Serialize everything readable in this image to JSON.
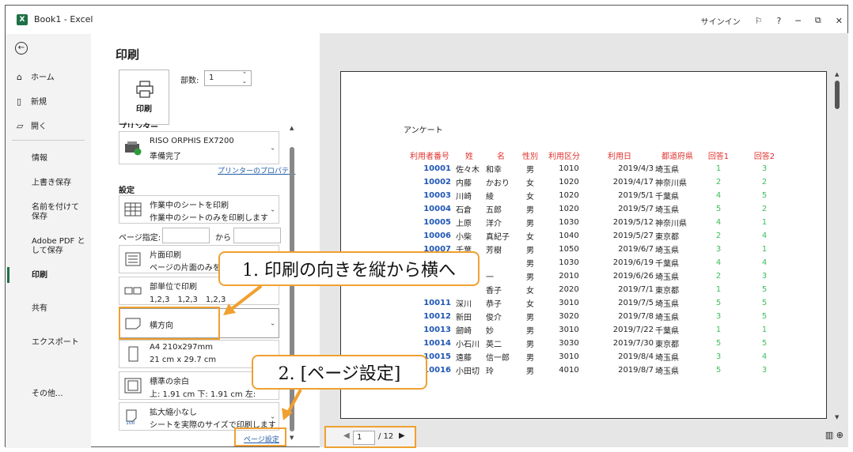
{
  "window": {
    "app_icon": "X",
    "title": "Book1 - Excel",
    "sign_in": "サインイン",
    "help": "?",
    "minimize": "─",
    "restore": "⧉",
    "close": "✕"
  },
  "backstage": {
    "back_icon": "←",
    "items": [
      {
        "icon": "⌂",
        "label": "ホーム"
      },
      {
        "icon": "▯",
        "label": "新規"
      },
      {
        "icon": "▱",
        "label": "開く"
      }
    ],
    "sub_items": [
      "情報",
      "上書き保存",
      "名前を付けて保存",
      "Adobe PDF として保存",
      "印刷",
      "共有",
      "エクスポート",
      "その他..."
    ]
  },
  "print": {
    "heading": "印刷",
    "print_button": "印刷",
    "copies_label": "部数:",
    "copies_value": "1",
    "printer_section": "プリンター",
    "printer_name": "RISO ORPHIS EX7200",
    "printer_status": "準備完了",
    "printer_properties": "プリンターのプロパティ",
    "settings_section": "設定",
    "scope_title": "作業中のシートを印刷",
    "scope_desc": "作業中のシートのみを印刷します",
    "pages_label": "ページ指定:",
    "pages_to": "から",
    "sides_title": "片面印刷",
    "sides_desc": "ページの片面のみを印刷",
    "collate_title": "部単位で印刷",
    "collate_desc": "1,2,3　1,2,3　1,2,3",
    "orientation": "横方向",
    "paper_title": "A4 210x297mm",
    "paper_desc": "21 cm x 29.7 cm",
    "margins_title": "標準の余白",
    "margins_desc": "上: 1.91 cm 下: 1.91 cm 左:",
    "scaling_title": "拡大縮小なし",
    "scaling_desc": "シートを実際のサイズで印刷します",
    "page_setup_link": "ページ設定"
  },
  "preview": {
    "sheet_title": "アンケート",
    "headers": [
      "利用者番号",
      "姓",
      "名",
      "性別",
      "利用区分",
      "利用日",
      "都道府県",
      "回答1",
      "回答2"
    ],
    "rows": [
      [
        "10001",
        "佐々木",
        "和幸",
        "男",
        "1010",
        "2019/4/3",
        "埼玉県",
        "1",
        "3"
      ],
      [
        "10002",
        "内藤",
        "かおり",
        "女",
        "1020",
        "2019/4/17",
        "神奈川県",
        "2",
        "2"
      ],
      [
        "10003",
        "川崎",
        "綾",
        "女",
        "1020",
        "2019/5/1",
        "千葉県",
        "4",
        "5"
      ],
      [
        "10004",
        "石倉",
        "五郎",
        "男",
        "1020",
        "2019/5/7",
        "埼玉県",
        "5",
        "2"
      ],
      [
        "10005",
        "上原",
        "洋介",
        "男",
        "1030",
        "2019/5/12",
        "神奈川県",
        "4",
        "1"
      ],
      [
        "10006",
        "小柴",
        "真紀子",
        "女",
        "1040",
        "2019/5/27",
        "東京都",
        "2",
        "4"
      ],
      [
        "10007",
        "千葉",
        "芳樹",
        "男",
        "1050",
        "2019/6/7",
        "埼玉県",
        "3",
        "1"
      ],
      [
        "",
        "",
        "",
        "男",
        "1030",
        "2019/6/19",
        "千葉県",
        "4",
        "4"
      ],
      [
        "",
        "",
        "一",
        "男",
        "2010",
        "2019/6/26",
        "埼玉県",
        "2",
        "3"
      ],
      [
        "",
        "",
        "香子",
        "女",
        "2020",
        "2019/7/1",
        "東京都",
        "1",
        "5"
      ],
      [
        "10011",
        "深川",
        "恭子",
        "女",
        "3010",
        "2019/7/5",
        "埼玉県",
        "5",
        "5"
      ],
      [
        "10012",
        "新田",
        "俊介",
        "男",
        "3020",
        "2019/7/8",
        "埼玉県",
        "3",
        "5"
      ],
      [
        "10013",
        "劒崎",
        "妙",
        "男",
        "3010",
        "2019/7/22",
        "千葉県",
        "1",
        "1"
      ],
      [
        "10014",
        "小石川",
        "英二",
        "男",
        "3030",
        "2019/7/30",
        "東京都",
        "5",
        "5"
      ],
      [
        "10015",
        "遠藤",
        "信一郎",
        "男",
        "3010",
        "2019/8/4",
        "埼玉県",
        "3",
        "4"
      ],
      [
        "10016",
        "小田切",
        "玲",
        "男",
        "4010",
        "2019/8/7",
        "埼玉県",
        "5",
        "3"
      ]
    ],
    "page_current": "1",
    "page_total": "/ 12"
  },
  "callouts": {
    "step1": "1. 印刷の向きを縦から横へ",
    "step2": "2. [ページ設定]"
  },
  "colors": {
    "accent": "#f0a030",
    "header_red": "#e0312d",
    "id_blue": "#1f56b5",
    "answer_green": "#3bbf5a",
    "excel_green": "#1e7145"
  }
}
